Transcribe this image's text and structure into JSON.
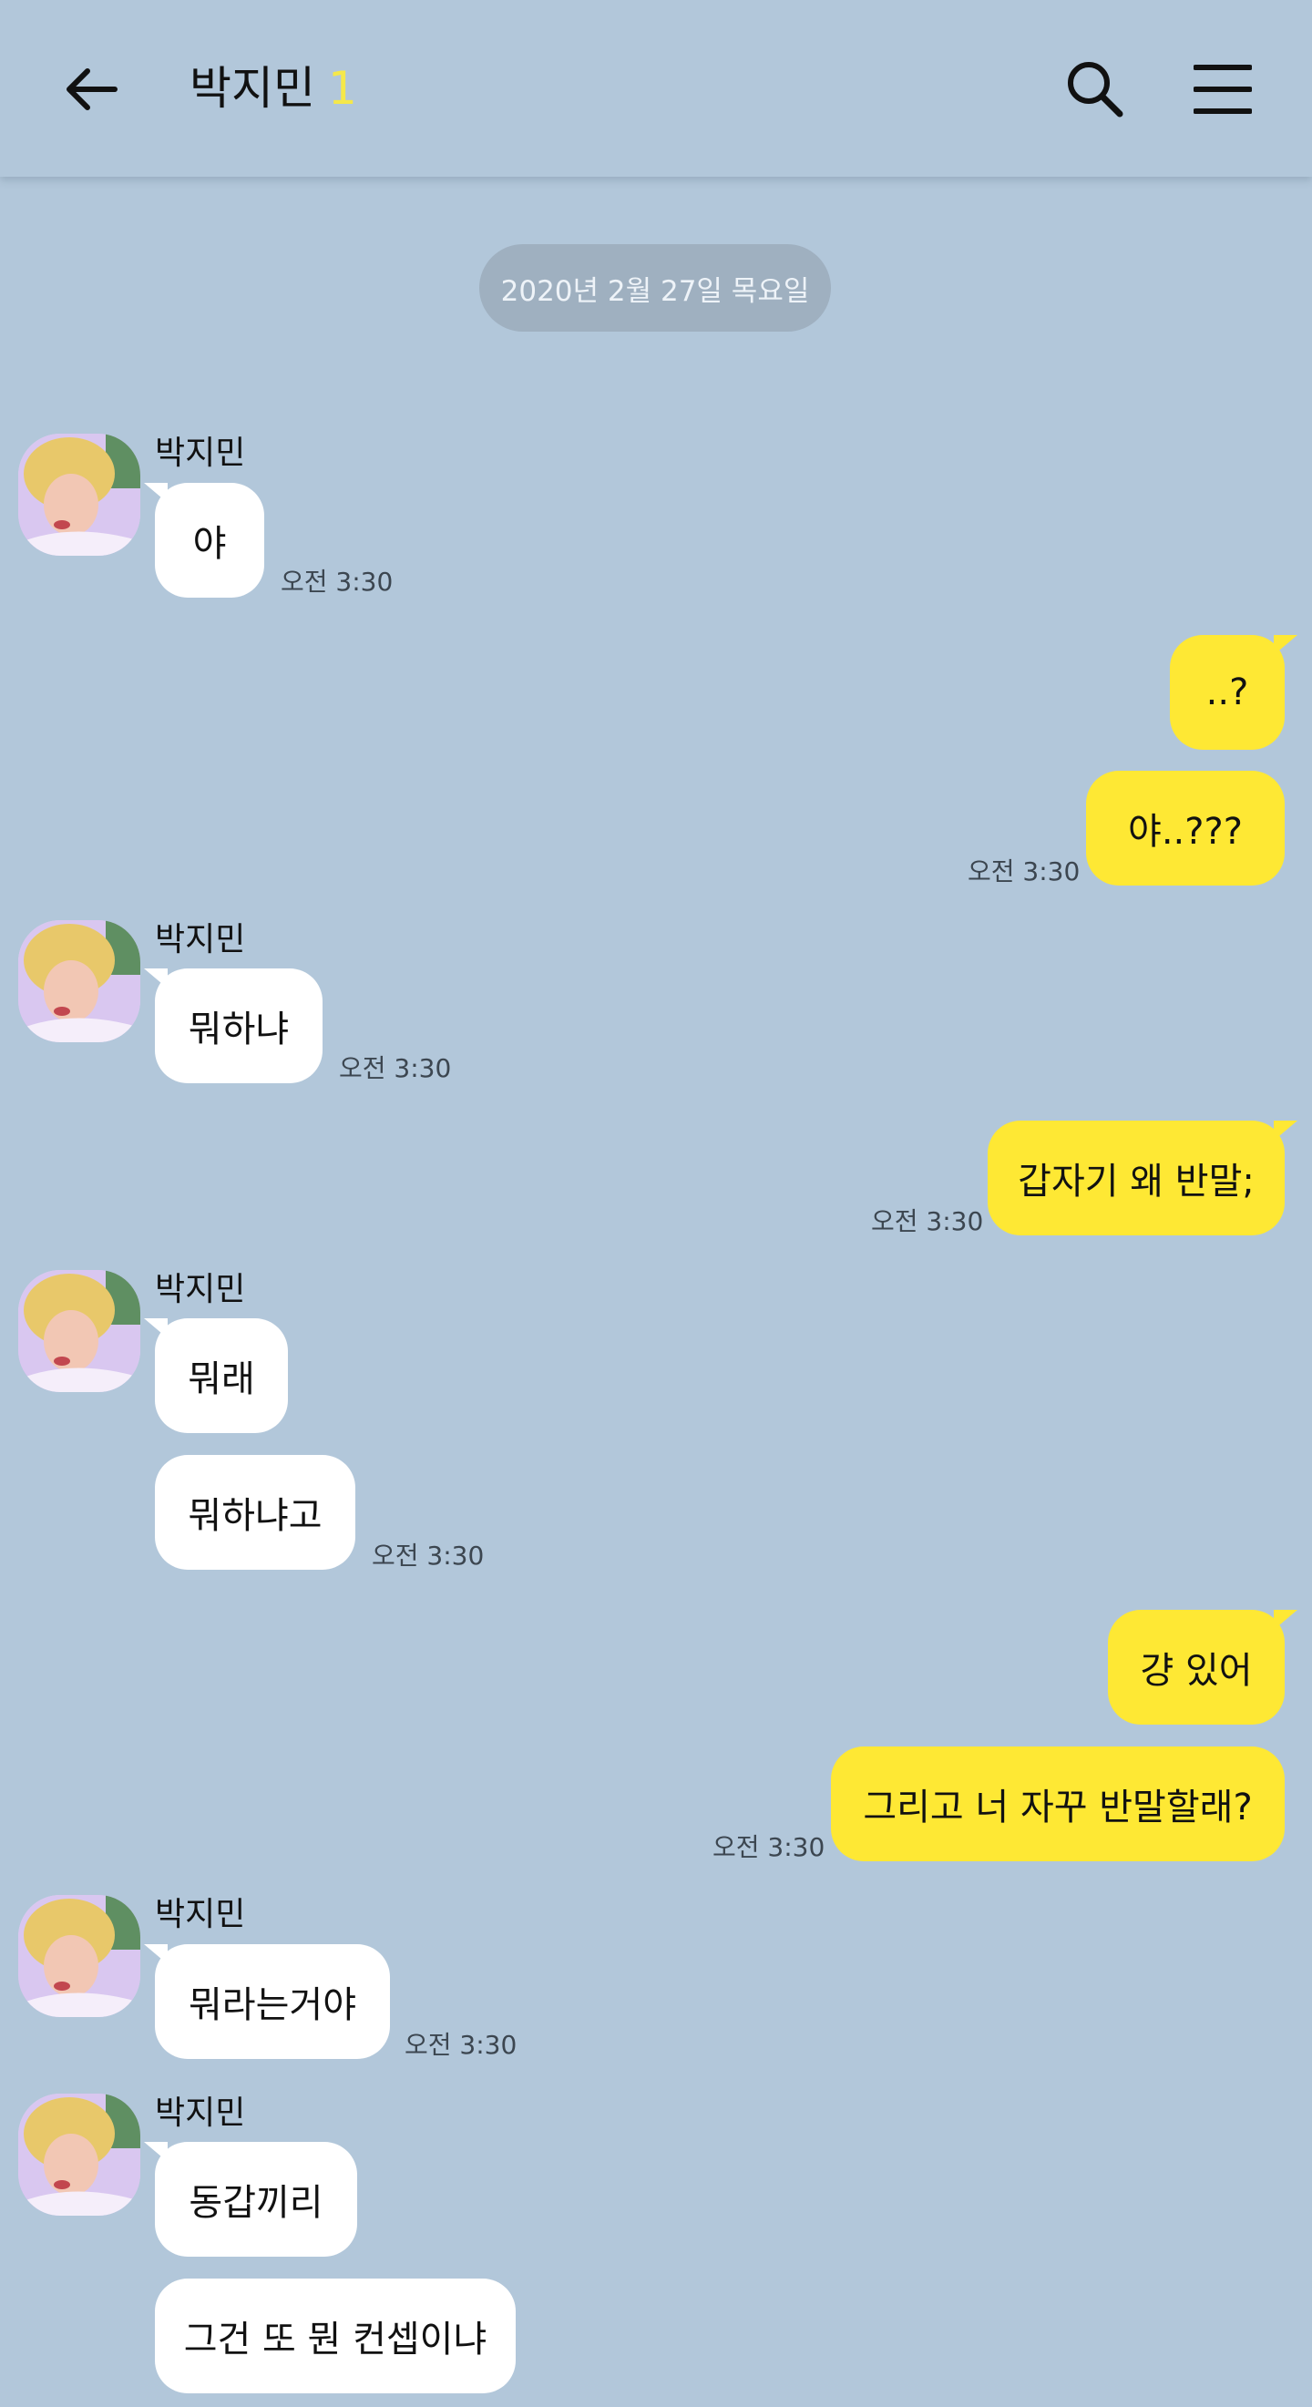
{
  "header": {
    "title": "박지민",
    "member_count": "1",
    "back_icon": "back-arrow-icon",
    "search_icon": "search-icon",
    "menu_icon": "menu-icon"
  },
  "date_divider": "2020년 2월 27일 목요일",
  "messages": [
    {
      "sender": "박지민",
      "text": "야",
      "time": "오전 3:30"
    },
    {
      "text": "..?"
    },
    {
      "text": "야..???",
      "time": "오전 3:30"
    },
    {
      "sender": "박지민",
      "text": "뭐하냐",
      "time": "오전 3:30"
    },
    {
      "text": "갑자기 왜 반말;",
      "time": "오전 3:30"
    },
    {
      "sender": "박지민",
      "text": "뭐래"
    },
    {
      "text": "뭐하냐고",
      "time": "오전 3:30"
    },
    {
      "text": "걍 있어"
    },
    {
      "text": "그리고 너 자꾸 반말할래?",
      "time": "오전 3:30"
    },
    {
      "sender": "박지민",
      "text": "뭐라는거야",
      "time": "오전 3:30"
    },
    {
      "sender": "박지민",
      "text": "동갑끼리"
    },
    {
      "text": "그건 또 뭔 컨셉이냐"
    }
  ],
  "colors": {
    "background": "#b2c7da",
    "incoming_bubble": "#ffffff",
    "outgoing_bubble": "#fee834",
    "member_count": "#f5e84a"
  }
}
